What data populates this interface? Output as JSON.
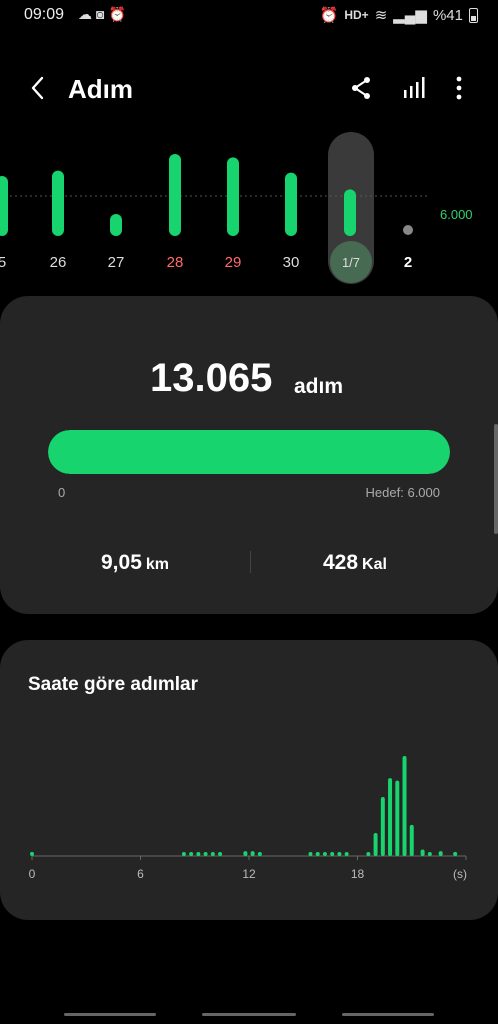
{
  "status": {
    "time": "09:09",
    "left_icons": [
      "cloud-icon",
      "screen-record-icon",
      "alarm-icon"
    ],
    "hd": "HD+",
    "battery": "%41"
  },
  "header": {
    "title": "Adım",
    "actions": [
      "share-icon",
      "chart-icon",
      "more-icon"
    ]
  },
  "week": {
    "goal_label": "6.000",
    "days": [
      {
        "label": "5",
        "value": 9000,
        "weekend": false
      },
      {
        "label": "26",
        "value": 9800,
        "weekend": false
      },
      {
        "label": "27",
        "value": 3300,
        "weekend": false
      },
      {
        "label": "28",
        "value": 12300,
        "weekend": true
      },
      {
        "label": "29",
        "value": 11800,
        "weekend": true
      },
      {
        "label": "30",
        "value": 9500,
        "weekend": false
      },
      {
        "label": "1/7",
        "value": 7000,
        "weekend": false,
        "selected": true
      },
      {
        "label": "2",
        "value": 0,
        "weekend": false,
        "bold": true
      }
    ],
    "accent": "#17d46e"
  },
  "summary": {
    "steps": "13.065",
    "steps_unit": "adım",
    "progress_min": "0",
    "goal_text": "Hedef: 6.000",
    "progress_fraction": 1.0,
    "distance_value": "9,05",
    "distance_unit": "km",
    "calories_value": "428",
    "calories_unit": "Kal"
  },
  "hourly": {
    "title": "Saate göre adımlar",
    "tick_labels": [
      "0",
      "6",
      "12",
      "18",
      "(s)"
    ],
    "chart_data": {
      "type": "bar",
      "x": [
        0,
        8.4,
        8.8,
        9.2,
        9.6,
        10.0,
        10.4,
        11.8,
        12.2,
        12.6,
        15.4,
        15.8,
        16.2,
        16.6,
        17.0,
        17.4,
        18.6,
        19.0,
        19.4,
        19.8,
        20.2,
        20.6,
        21.0,
        21.6,
        22.0,
        22.6,
        23.4
      ],
      "values": [
        5,
        4,
        4,
        4,
        4,
        4,
        4,
        6,
        6,
        4,
        4,
        4,
        4,
        4,
        4,
        4,
        4,
        28,
        72,
        95,
        92,
        122,
        38,
        8,
        4,
        6,
        5
      ],
      "xlim": [
        0,
        24
      ],
      "xlabel": "(s)"
    }
  }
}
